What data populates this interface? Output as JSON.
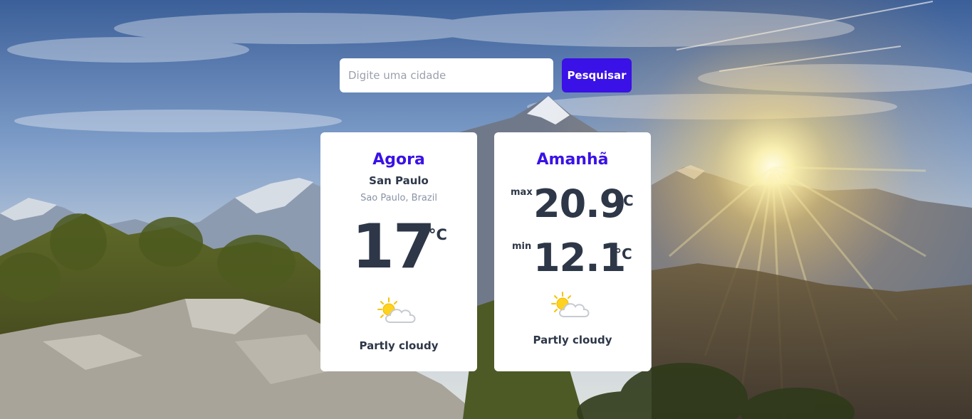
{
  "search": {
    "placeholder": "Digite uma cidade",
    "value": "",
    "button_label": "Pesquisar"
  },
  "now": {
    "title": "Agora",
    "city": "San Paulo",
    "region": "Sao Paulo, Brazil",
    "temperature": "17",
    "unit": "°C",
    "icon": "partly-cloudy-icon",
    "condition": "Partly cloudy"
  },
  "tomorrow": {
    "title": "Amanhã",
    "max_label": "max",
    "max_value": "20.9",
    "min_label": "min",
    "min_value": "12.1",
    "unit": "°C",
    "icon": "partly-cloudy-icon",
    "condition": "Partly cloudy"
  },
  "colors": {
    "accent": "#3a11e6",
    "text": "#2d3748",
    "muted": "#8a93a6",
    "card": "#ffffff"
  }
}
